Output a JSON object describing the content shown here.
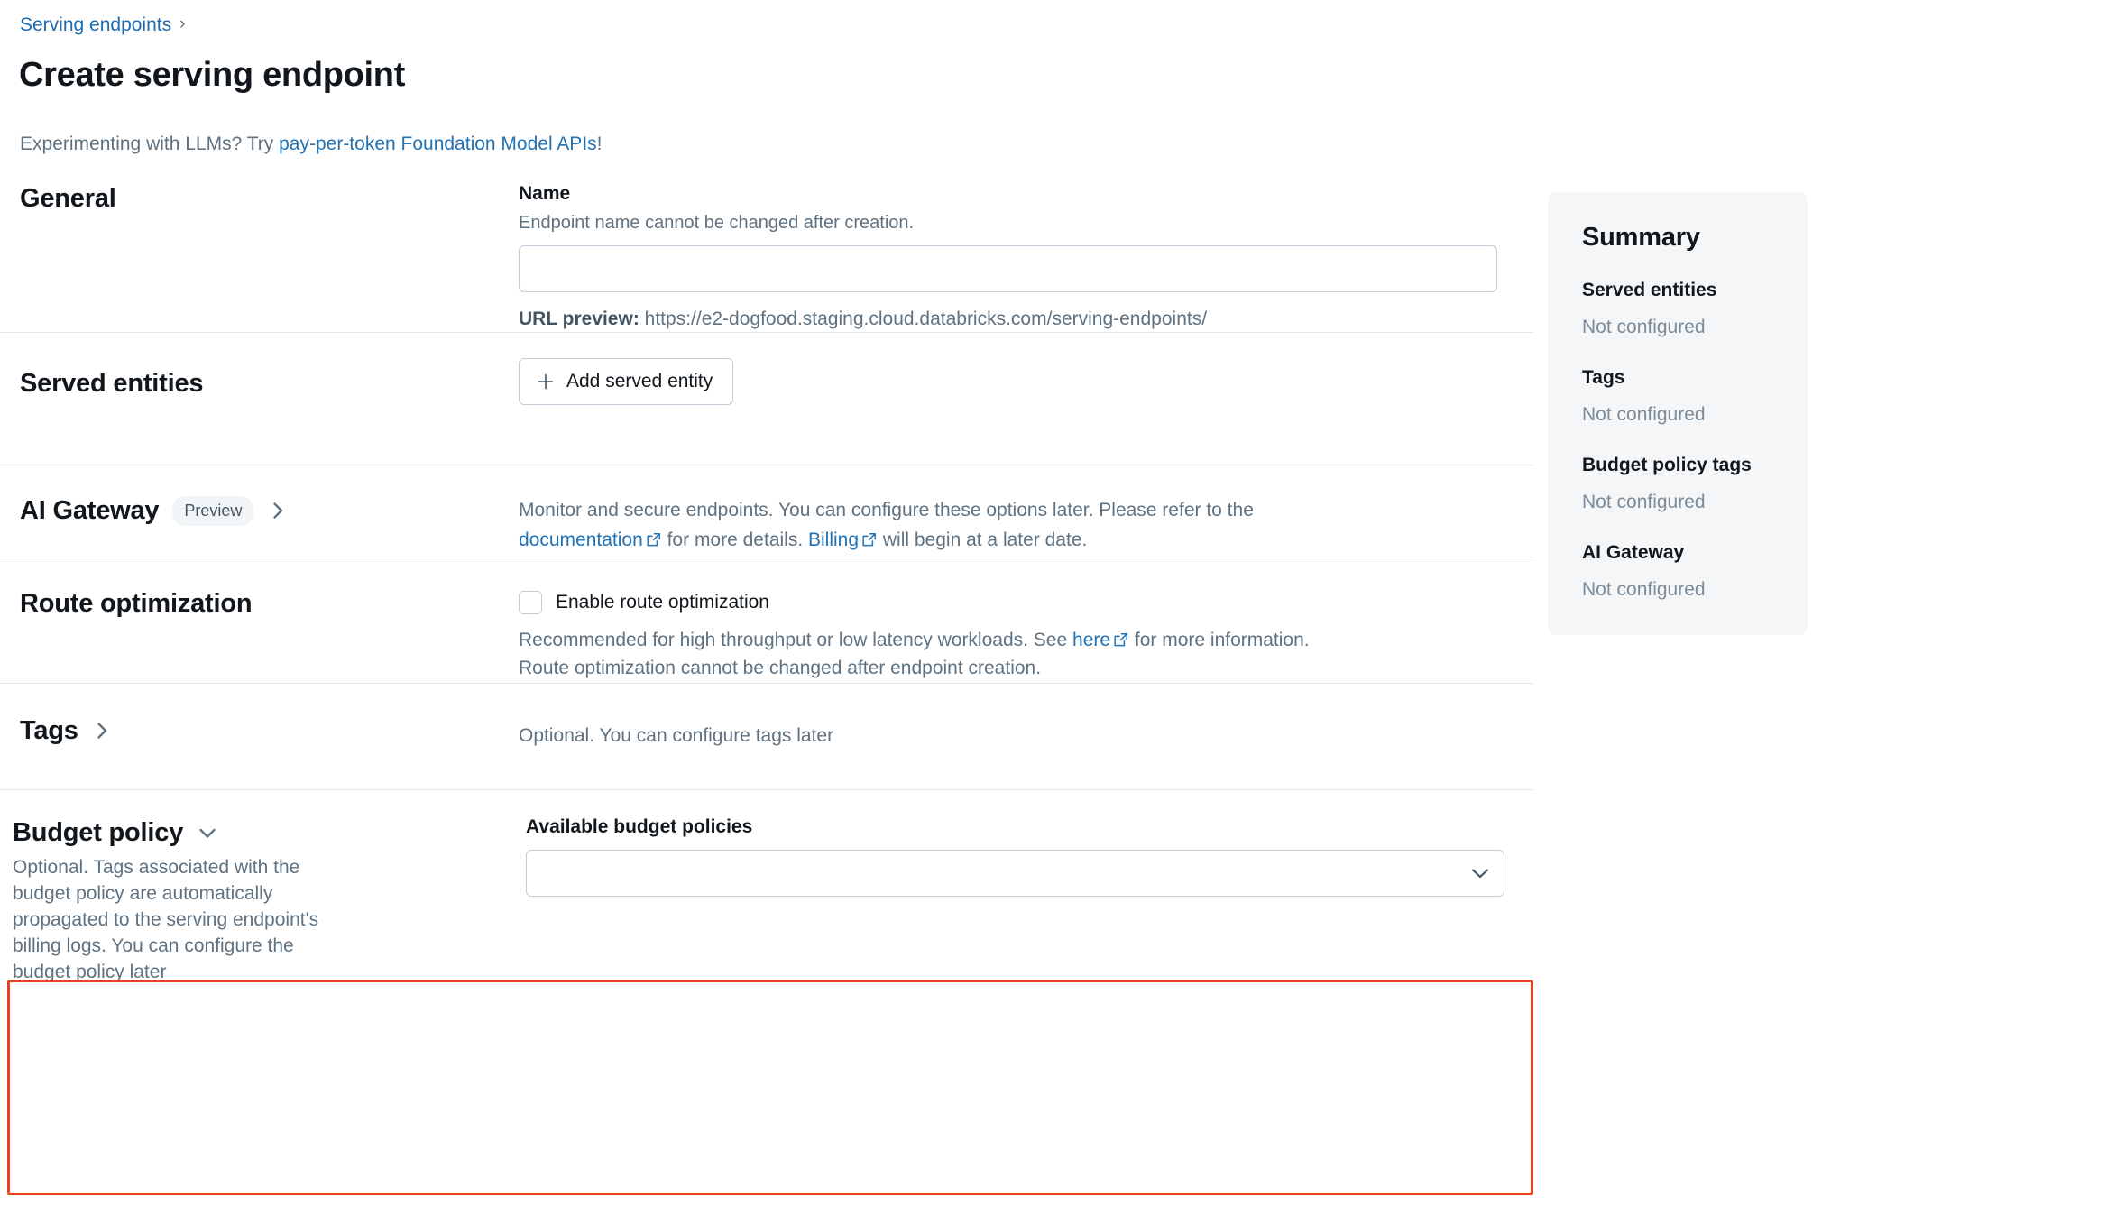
{
  "breadcrumb": {
    "parent": "Serving endpoints",
    "separator": "›"
  },
  "page_title": "Create serving endpoint",
  "subtitle": {
    "prefix": "Experimenting with LLMs? Try ",
    "link": "pay-per-token Foundation Model APIs",
    "suffix": "!"
  },
  "general": {
    "heading": "General",
    "name_label": "Name",
    "name_help": "Endpoint name cannot be changed after creation.",
    "name_value": "",
    "name_placeholder": "",
    "url_preview_label": "URL preview:",
    "url_preview_value": "https://e2-dogfood.staging.cloud.databricks.com/serving-endpoints/"
  },
  "served_entities": {
    "heading": "Served entities",
    "add_button": "Add served entity"
  },
  "ai_gateway": {
    "heading": "AI Gateway",
    "badge": "Preview",
    "desc_part1": "Monitor and secure endpoints. You can configure these options later. Please refer to the ",
    "link_documentation": "documentation",
    "desc_part2": " for more details. ",
    "link_billing": "Billing",
    "desc_part3": " will begin at a later date."
  },
  "route_optimization": {
    "heading": "Route optimization",
    "checkbox_label": "Enable route optimization",
    "checkbox_checked": false,
    "help_part1": "Recommended for high throughput or low latency workloads. See ",
    "help_link": "here",
    "help_part2": " for more information.",
    "help_line2": "Route optimization cannot be changed after endpoint creation."
  },
  "tags": {
    "heading": "Tags",
    "desc": "Optional. You can configure tags later"
  },
  "budget_policy": {
    "heading": "Budget policy",
    "desc": "Optional. Tags associated with the budget policy are automatically propagated to the serving endpoint's billing logs. You can configure the budget policy later",
    "field_label": "Available budget policies",
    "selected_value": "",
    "highlighted": true
  },
  "summary": {
    "title": "Summary",
    "items": [
      {
        "label": "Served entities",
        "value": "Not configured"
      },
      {
        "label": "Tags",
        "value": "Not configured"
      },
      {
        "label": "Budget policy tags",
        "value": "Not configured"
      },
      {
        "label": "AI Gateway",
        "value": "Not configured"
      }
    ]
  },
  "colors": {
    "link": "#2272b4",
    "highlight": "#e8401c",
    "muted_text": "#5f7281",
    "panel_bg": "#f4f6f7"
  }
}
